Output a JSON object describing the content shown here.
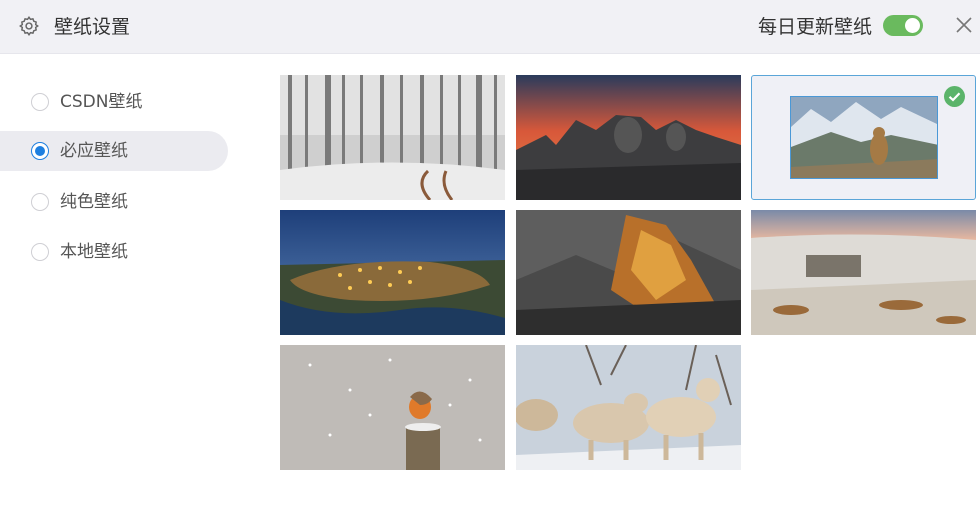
{
  "header": {
    "title": "壁纸设置",
    "daily_update_label": "每日更新壁纸",
    "daily_update_on": true,
    "icons": {
      "settings": "gear-icon",
      "close": "close-icon"
    }
  },
  "sidebar": {
    "options": [
      {
        "label": "CSDN壁纸",
        "selected": false
      },
      {
        "label": "必应壁纸",
        "selected": true
      },
      {
        "label": "纯色壁纸",
        "selected": false
      },
      {
        "label": "本地壁纸",
        "selected": false
      }
    ]
  },
  "wallpapers": {
    "selected_index": 2,
    "items": [
      {
        "scene": "snowy-forest-path"
      },
      {
        "scene": "stone-heads-sunset"
      },
      {
        "scene": "marmot-mountains"
      },
      {
        "scene": "city-night-river"
      },
      {
        "scene": "golden-rock-cliff"
      },
      {
        "scene": "snowy-moorland-ruins"
      },
      {
        "scene": "robin-in-snow"
      },
      {
        "scene": "arctic-wolves"
      }
    ]
  },
  "colors": {
    "accent": "#1e7fe0",
    "toggle_on": "#6aba5e",
    "check": "#5bb46a",
    "selected_border": "#5aa5d8"
  }
}
